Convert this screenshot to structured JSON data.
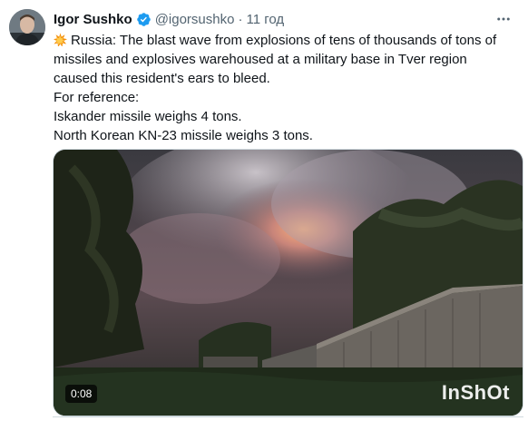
{
  "tweet": {
    "author_name": "Igor Sushko",
    "author_handle": "@igorsushko",
    "separator": "·",
    "timestamp": "11 год",
    "emoji_icon": "collision-icon",
    "lines": [
      "Russia: The blast wave from explosions of tens of thousands of tons of missiles and explosives warehoused at a military base in Tver region caused this resident's ears to bleed.",
      "For reference:",
      "Iskander missile weighs 4 tons.",
      "North Korean KN-23 missile weighs 3 tons."
    ],
    "video": {
      "duration": "0:08",
      "watermark": "InShOt"
    }
  },
  "colors": {
    "text_primary": "#0f1419",
    "text_secondary": "#536471",
    "verified_blue": "#1d9bf0",
    "border": "#cfd9de"
  }
}
